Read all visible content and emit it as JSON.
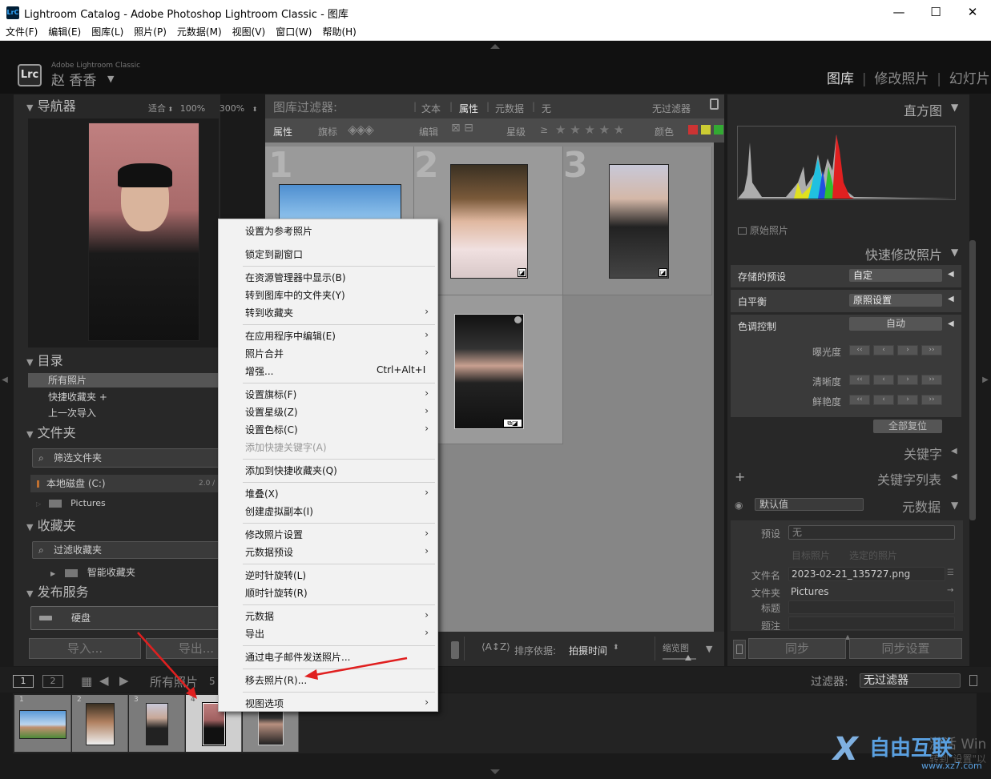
{
  "window": {
    "title": "Lightroom Catalog - Adobe Photoshop Lightroom Classic - 图库",
    "logo": "LrC",
    "minimize": "—",
    "maximize": "☐",
    "close": "✕"
  },
  "menu": [
    "文件(F)",
    "编辑(E)",
    "图库(L)",
    "照片(P)",
    "元数据(M)",
    "视图(V)",
    "窗口(W)",
    "帮助(H)"
  ],
  "identity": {
    "product": "Adobe Lightroom Classic",
    "user": "赵 香香",
    "logo": "Lrc"
  },
  "modules": [
    "图库",
    "修改照片",
    "幻灯片"
  ],
  "navigator": {
    "title": "导航器",
    "zoom_fit": "适合",
    "zoom_100": "100%",
    "zoom_300": "300%"
  },
  "catalog": {
    "title": "目录",
    "items": [
      "所有照片",
      "快捷收藏夹 +",
      "上一次导入"
    ]
  },
  "folders": {
    "title": "文件夹",
    "filter": "筛选文件夹",
    "disk": "本地磁盘 (C:)",
    "disk_size": "2.0 /",
    "folder": "Pictures"
  },
  "collections": {
    "title": "收藏夹",
    "filter": "过滤收藏夹",
    "smart": "智能收藏夹"
  },
  "publish": {
    "title": "发布服务",
    "hard_disk": "硬盘"
  },
  "left_buttons": {
    "import": "导入...",
    "export": "导出..."
  },
  "filter_bar": {
    "label": "图库过滤器:",
    "tabs": [
      "文本",
      "属性",
      "元数据",
      "无"
    ],
    "no_filter": "无过滤器",
    "attr_label": "属性",
    "flag_label": "旗标",
    "edit_label": "编辑",
    "rating_label": "星级",
    "gte": "≥",
    "stars": "★ ★ ★ ★ ★",
    "color_label": "颜色"
  },
  "grid": {
    "cells": [
      "1",
      "2",
      "3"
    ]
  },
  "toolbar": {
    "sort_label": "排序依据:",
    "sort_value": "拍摄时间",
    "thumb_label": "缩览图"
  },
  "right": {
    "histogram": "直方图",
    "original": "原始照片",
    "quick_develop": "快速修改照片",
    "saved_preset_label": "存储的预设",
    "saved_preset_value": "自定",
    "wb_label": "白平衡",
    "wb_value": "原照设置",
    "tone_label": "色调控制",
    "auto": "自动",
    "exposure": "曝光度",
    "clarity": "清晰度",
    "vibrance": "鲜艳度",
    "reset_all": "全部复位",
    "keywords": "关键字",
    "keyword_list": "关键字列表",
    "metadata": "元数据",
    "default": "默认值",
    "preset_label": "预设",
    "preset_value": "无",
    "target_photo": "目标照片",
    "selected_photos": "选定的照片",
    "filename_label": "文件名",
    "filename_value": "2023-02-21_135727.png",
    "folder_label": "文件夹",
    "folder_value": "Pictures",
    "title_label": "标题",
    "caption_label": "题注",
    "sync": "同步",
    "sync_settings": "同步设置"
  },
  "filmstrip": {
    "view1": "1",
    "view2": "2",
    "source": "所有照片",
    "count": "5",
    "filter_label": "过滤器:",
    "filter_value": "无过滤器",
    "nums": [
      "1",
      "2",
      "3",
      "4",
      ""
    ]
  },
  "context_menu": [
    {
      "label": "设置为参考照片"
    },
    {
      "label": "锁定到副窗口"
    },
    {
      "label": "在资源管理器中显示(B)"
    },
    {
      "label": "转到图库中的文件夹(Y)"
    },
    {
      "label": "转到收藏夹"
    },
    {
      "label": "在应用程序中编辑(E)"
    },
    {
      "label": "照片合并"
    },
    {
      "label": "增强...",
      "shortcut": "Ctrl+Alt+I"
    },
    {
      "label": "设置旗标(F)"
    },
    {
      "label": "设置星级(Z)"
    },
    {
      "label": "设置色标(C)"
    },
    {
      "label": "添加快捷关键字(A)"
    },
    {
      "label": "添加到快捷收藏夹(Q)"
    },
    {
      "label": "堆叠(X)"
    },
    {
      "label": "创建虚拟副本(I)"
    },
    {
      "label": "修改照片设置"
    },
    {
      "label": "元数据预设"
    },
    {
      "label": "逆时针旋转(L)"
    },
    {
      "label": "顺时针旋转(R)"
    },
    {
      "label": "元数据"
    },
    {
      "label": "导出"
    },
    {
      "label": "通过电子邮件发送照片..."
    },
    {
      "label": "移去照片(R)..."
    },
    {
      "label": "视图选项"
    }
  ],
  "watermark": {
    "text": "自由互联",
    "url": "www.xz7.com",
    "activate": "激活 Win",
    "activate2": "转到\"设置\"以"
  },
  "colors": {
    "bg": "#1a1a1a",
    "panel": "#303030",
    "grid": "#9a9a9a",
    "menu": "#f2f2f2",
    "arrow": "#e02020"
  }
}
